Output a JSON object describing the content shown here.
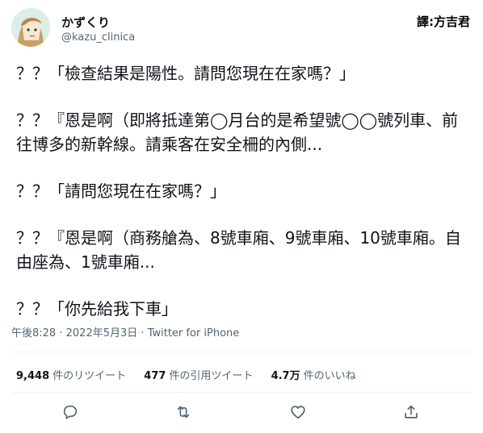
{
  "user": {
    "name": "かずくり",
    "handle": "@kazu_clinica"
  },
  "watermark": "譯:方吉君",
  "tweet": {
    "paragraphs": [
      "？？「檢查結果是陽性。請問您現在在家嗎？」",
      "？？『恩是啊（即將抵達第◯月台的是希望號◯◯號列車、前往博多的新幹線。請乘客在安全柵的內側...",
      "？？「請問您現在在家嗎？」",
      "？？『恩是啊（商務艙為、8號車廂、9號車廂、10號車廂。自由座為、1號車廂...",
      "？？「你先給我下車」"
    ]
  },
  "meta": {
    "time": "午後8:28",
    "separator": "·",
    "date": "2022年5月3日",
    "source": "Twitter for iPhone"
  },
  "stats": {
    "retweets": {
      "value": "9,448",
      "label": "件のリツイート"
    },
    "quotes": {
      "value": "477",
      "label": "件の引用ツイート"
    },
    "likes": {
      "value": "4.7万",
      "label": "件のいいね"
    }
  },
  "icons": {
    "reply": "reply-icon",
    "retweet": "retweet-icon",
    "like": "heart-icon",
    "share": "share-icon"
  },
  "colors": {
    "text": "#0f1419",
    "secondary": "#536471",
    "divider": "#eff3f4"
  }
}
